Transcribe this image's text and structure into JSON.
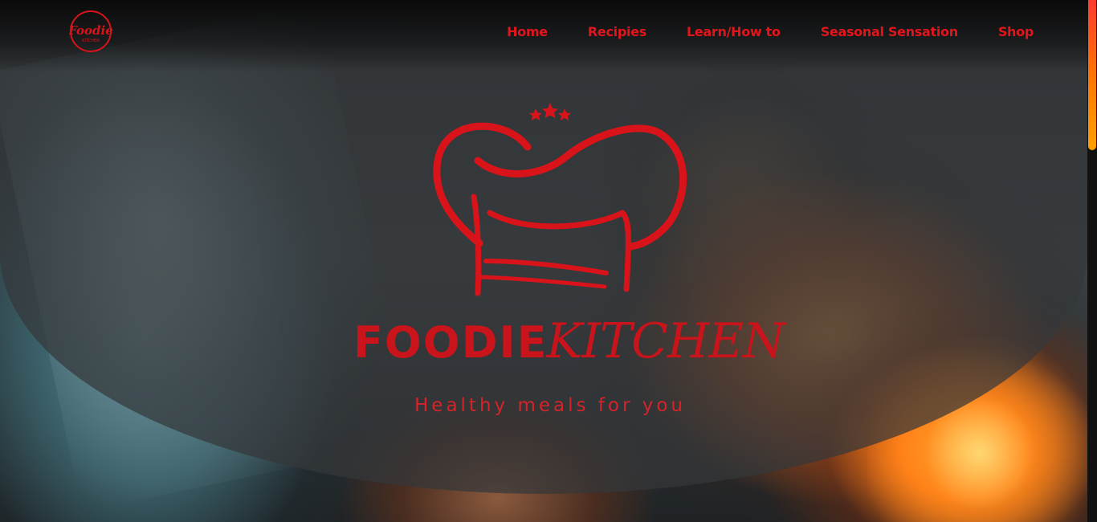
{
  "brand": {
    "logo_script": "Foodie",
    "logo_sub": "KITCHEN"
  },
  "nav": {
    "items": [
      {
        "label": "Home"
      },
      {
        "label": "Recipies"
      },
      {
        "label": "Learn/How to"
      },
      {
        "label": "Seasonal Sensation"
      },
      {
        "label": "Shop"
      }
    ]
  },
  "hero": {
    "title_part1": "FOODIE",
    "title_part2": "KITCHEN",
    "tagline": "Healthy meals for you"
  },
  "colors": {
    "accent": "#e0161c",
    "overlay": "#34383a",
    "scroll_thumb": "#ff7a00"
  },
  "icons": {
    "brand": "chef-hat-logo",
    "stars": "star-icon"
  }
}
